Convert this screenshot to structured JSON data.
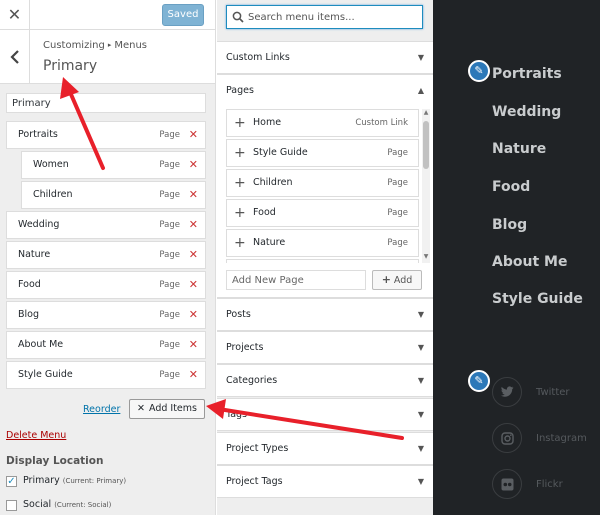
{
  "app": {
    "close_label": "✕",
    "saved_label": "Saved"
  },
  "section": {
    "breadcrumb_parent": "Customizing",
    "breadcrumb_sep": "▸",
    "breadcrumb_child": "Menus",
    "title": "Primary",
    "menu_name_value": "Primary"
  },
  "menu_items": [
    {
      "label": "Portraits",
      "type": "Page",
      "level": 0
    },
    {
      "label": "Women",
      "type": "Page",
      "level": 1
    },
    {
      "label": "Children",
      "type": "Page",
      "level": 1
    },
    {
      "label": "Wedding",
      "type": "Page",
      "level": 0
    },
    {
      "label": "Nature",
      "type": "Page",
      "level": 0
    },
    {
      "label": "Food",
      "type": "Page",
      "level": 0
    },
    {
      "label": "Blog",
      "type": "Page",
      "level": 0
    },
    {
      "label": "About Me",
      "type": "Page",
      "level": 0
    },
    {
      "label": "Style Guide",
      "type": "Page",
      "level": 0
    }
  ],
  "actions": {
    "reorder_label": "Reorder",
    "add_items_label": "Add Items",
    "delete_menu_label": "Delete Menu"
  },
  "display_location": {
    "heading": "Display Location",
    "options": [
      {
        "label": "Primary",
        "note": "(Current: Primary)",
        "checked": true
      },
      {
        "label": "Social",
        "note": "(Current: Social)",
        "checked": false
      }
    ]
  },
  "add_panel": {
    "search_placeholder": "Search menu items...",
    "custom_links_label": "Custom Links",
    "pages_label": "Pages",
    "pages": [
      {
        "label": "Home",
        "type": "Custom Link"
      },
      {
        "label": "Style Guide",
        "type": "Page"
      },
      {
        "label": "Children",
        "type": "Page"
      },
      {
        "label": "Food",
        "type": "Page"
      },
      {
        "label": "Nature",
        "type": "Page"
      },
      {
        "label": "",
        "type": ""
      }
    ],
    "new_page_placeholder": "Add New Page",
    "add_button_label": "Add",
    "sections": [
      "Posts",
      "Projects",
      "Categories",
      "Tags",
      "Project Types",
      "Project Tags"
    ]
  },
  "preview": {
    "nav": [
      "Portraits",
      "Wedding",
      "Nature",
      "Food",
      "Blog",
      "About Me",
      "Style Guide"
    ],
    "social": [
      "Twitter",
      "Instagram",
      "Flickr"
    ]
  },
  "colors": {
    "accent": "#0073aa",
    "delete_red": "#cc3333",
    "preview_bg": "#202326",
    "annotation_arrow": "#e8202a"
  }
}
